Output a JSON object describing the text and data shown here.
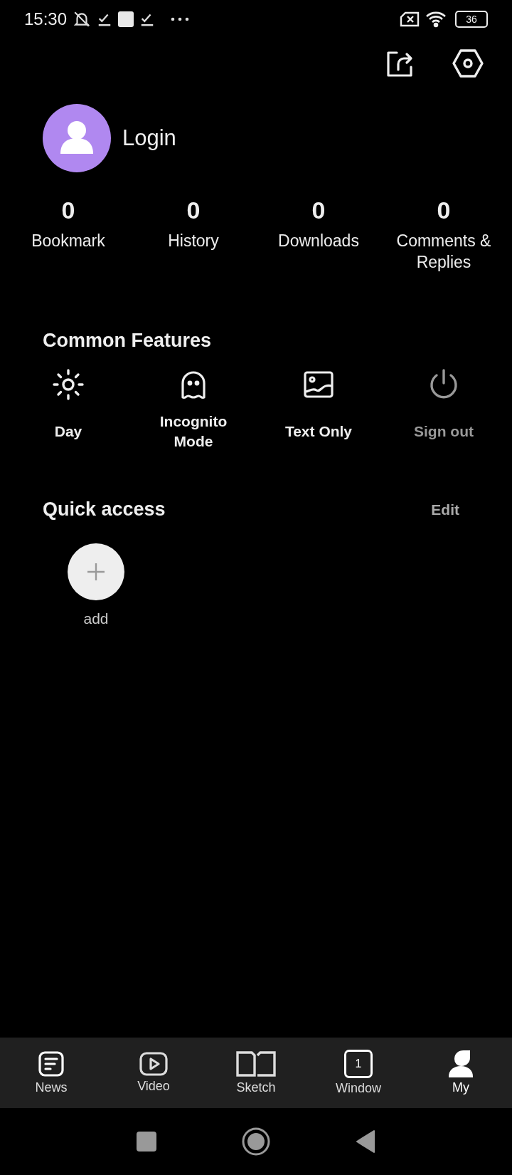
{
  "status_bar": {
    "time": "15:30",
    "battery": "36"
  },
  "profile": {
    "name": "Login"
  },
  "stats": [
    {
      "value": "0",
      "label": "Bookmark"
    },
    {
      "value": "0",
      "label": "History"
    },
    {
      "value": "0",
      "label": "Downloads"
    },
    {
      "value": "0",
      "label": "Comments & Replies"
    }
  ],
  "common_features": {
    "title": "Common Features",
    "items": [
      {
        "kind": "sun",
        "label": "Day",
        "disabled": false
      },
      {
        "kind": "ghost",
        "label": "Incognito Mode",
        "disabled": false
      },
      {
        "kind": "image",
        "label": "Text Only",
        "disabled": false
      },
      {
        "kind": "power",
        "label": "Sign out",
        "disabled": true
      }
    ]
  },
  "quick_access": {
    "title": "Quick access",
    "edit": "Edit",
    "add_label": "add"
  },
  "tabs": [
    {
      "kind": "news",
      "label": "News",
      "selected": false
    },
    {
      "kind": "video",
      "label": "Video",
      "selected": false
    },
    {
      "kind": "book",
      "label": "Sketch",
      "selected": false
    },
    {
      "kind": "window",
      "label": "Window",
      "selected": false,
      "badge": "1"
    },
    {
      "kind": "person",
      "label": "My",
      "selected": true
    }
  ]
}
